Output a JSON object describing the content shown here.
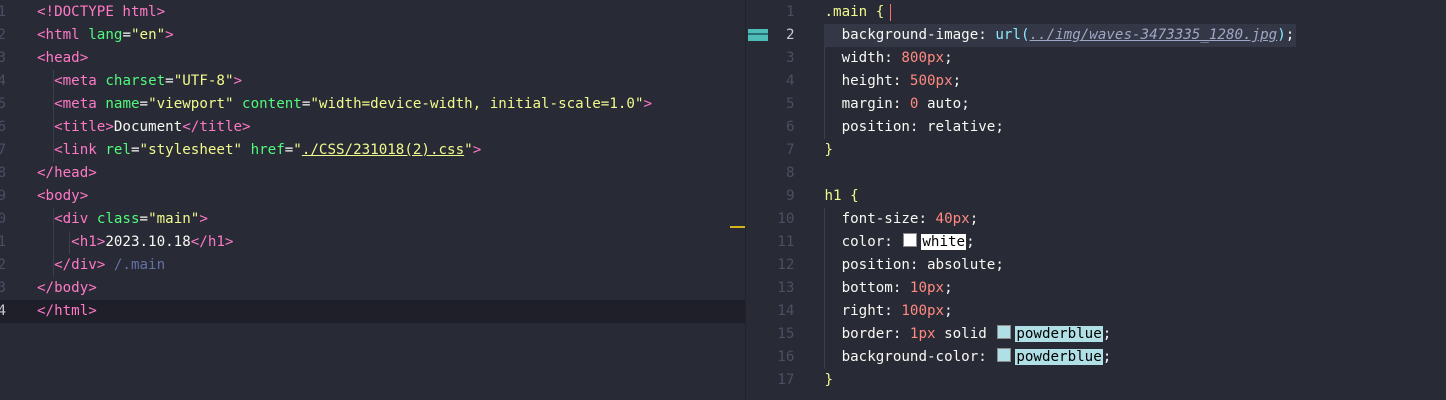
{
  "left_editor": {
    "file_language": "html",
    "lines": [
      {
        "n": "1",
        "parts": [
          [
            "tag",
            "<!DOCTYPE"
          ],
          [
            "txt",
            " "
          ],
          [
            "tag",
            "html"
          ],
          [
            "tag",
            ">"
          ]
        ]
      },
      {
        "n": "2",
        "parts": [
          [
            "tag",
            "<html"
          ],
          [
            "txt",
            " "
          ],
          [
            "attr",
            "lang"
          ],
          [
            "punc",
            "="
          ],
          [
            "str",
            "\"en\""
          ],
          [
            "tag",
            ">"
          ]
        ]
      },
      {
        "n": "3",
        "parts": [
          [
            "tag",
            "<head>"
          ]
        ]
      },
      {
        "n": "4",
        "parts": [
          [
            "txt",
            "  "
          ],
          [
            "tag",
            "<meta"
          ],
          [
            "txt",
            " "
          ],
          [
            "attr",
            "charset"
          ],
          [
            "punc",
            "="
          ],
          [
            "str",
            "\"UTF-8\""
          ],
          [
            "tag",
            ">"
          ]
        ]
      },
      {
        "n": "5",
        "parts": [
          [
            "txt",
            "  "
          ],
          [
            "tag",
            "<meta"
          ],
          [
            "txt",
            " "
          ],
          [
            "attr",
            "name"
          ],
          [
            "punc",
            "="
          ],
          [
            "str",
            "\"viewport\""
          ],
          [
            "txt",
            " "
          ],
          [
            "attr",
            "content"
          ],
          [
            "punc",
            "="
          ],
          [
            "str",
            "\"width=device-width, initial-scale=1.0\""
          ],
          [
            "tag",
            ">"
          ]
        ]
      },
      {
        "n": "6",
        "parts": [
          [
            "txt",
            "  "
          ],
          [
            "tag",
            "<title>"
          ],
          [
            "txt",
            "Document"
          ],
          [
            "tag",
            "</title>"
          ]
        ]
      },
      {
        "n": "7",
        "parts": [
          [
            "txt",
            "  "
          ],
          [
            "tag",
            "<link"
          ],
          [
            "txt",
            " "
          ],
          [
            "attr",
            "rel"
          ],
          [
            "punc",
            "="
          ],
          [
            "str",
            "\"stylesheet\""
          ],
          [
            "txt",
            " "
          ],
          [
            "attr",
            "href"
          ],
          [
            "punc",
            "="
          ],
          [
            "str",
            "\""
          ],
          [
            "link",
            "./CSS/231018(2).css"
          ],
          [
            "str",
            "\""
          ],
          [
            "tag",
            ">"
          ]
        ]
      },
      {
        "n": "8",
        "parts": [
          [
            "tag",
            "</head>"
          ]
        ]
      },
      {
        "n": "9",
        "parts": [
          [
            "tag",
            "<body>"
          ]
        ]
      },
      {
        "n": "0",
        "parts": [
          [
            "txt",
            "  "
          ],
          [
            "tag",
            "<div"
          ],
          [
            "txt",
            " "
          ],
          [
            "attr",
            "class"
          ],
          [
            "punc",
            "="
          ],
          [
            "str",
            "\"main\""
          ],
          [
            "tag",
            ">"
          ]
        ]
      },
      {
        "n": "1",
        "parts": [
          [
            "txt",
            "    "
          ],
          [
            "tag",
            "<h1>"
          ],
          [
            "txt",
            "2023.10.18"
          ],
          [
            "tag",
            "</h1>"
          ]
        ]
      },
      {
        "n": "2",
        "parts": [
          [
            "txt",
            "  "
          ],
          [
            "tag",
            "</div>"
          ],
          [
            "cmt",
            " /.main"
          ]
        ]
      },
      {
        "n": "3",
        "parts": [
          [
            "tag",
            "</body>"
          ]
        ]
      },
      {
        "n": "4",
        "parts": [
          [
            "tag",
            "</html>"
          ]
        ],
        "active": true
      }
    ]
  },
  "right_editor": {
    "file_language": "css",
    "lines": [
      {
        "n": "1",
        "parts": [
          [
            "sel",
            ".main"
          ],
          [
            "txt",
            " "
          ],
          [
            "sel",
            "{"
          ]
        ]
      },
      {
        "n": "2",
        "parts": [
          [
            "txt",
            "  "
          ],
          [
            "prop",
            "background-image"
          ],
          [
            "punc",
            ": "
          ],
          [
            "fn",
            "url("
          ],
          [
            "url",
            "../img/waves-3473335_1280.jpg"
          ],
          [
            "fn",
            ")"
          ],
          [
            "punc",
            ";"
          ]
        ],
        "highlight": true,
        "active": true
      },
      {
        "n": "3",
        "parts": [
          [
            "txt",
            "  "
          ],
          [
            "prop",
            "width"
          ],
          [
            "punc",
            ": "
          ],
          [
            "num",
            "800px"
          ],
          [
            "punc",
            ";"
          ]
        ]
      },
      {
        "n": "4",
        "parts": [
          [
            "txt",
            "  "
          ],
          [
            "prop",
            "height"
          ],
          [
            "punc",
            ": "
          ],
          [
            "num",
            "500px"
          ],
          [
            "punc",
            ";"
          ]
        ]
      },
      {
        "n": "5",
        "parts": [
          [
            "txt",
            "  "
          ],
          [
            "prop",
            "margin"
          ],
          [
            "punc",
            ": "
          ],
          [
            "num",
            "0"
          ],
          [
            "txt",
            " auto"
          ],
          [
            "punc",
            ";"
          ]
        ]
      },
      {
        "n": "6",
        "parts": [
          [
            "txt",
            "  "
          ],
          [
            "prop",
            "position"
          ],
          [
            "punc",
            ": "
          ],
          [
            "txt",
            "relative"
          ],
          [
            "punc",
            ";"
          ]
        ]
      },
      {
        "n": "7",
        "parts": [
          [
            "sel",
            "}"
          ]
        ]
      },
      {
        "n": "8",
        "parts": []
      },
      {
        "n": "9",
        "parts": [
          [
            "sel",
            "h1"
          ],
          [
            "txt",
            " "
          ],
          [
            "sel",
            "{"
          ]
        ]
      },
      {
        "n": "10",
        "parts": [
          [
            "txt",
            "  "
          ],
          [
            "prop",
            "font-size"
          ],
          [
            "punc",
            ": "
          ],
          [
            "num",
            "40px"
          ],
          [
            "punc",
            ";"
          ]
        ]
      },
      {
        "n": "11",
        "parts": [
          [
            "txt",
            "  "
          ],
          [
            "prop",
            "color"
          ],
          [
            "punc",
            ": "
          ],
          [
            "swatch",
            "#ffffff"
          ],
          [
            "box-white",
            "white"
          ],
          [
            "punc",
            ";"
          ]
        ]
      },
      {
        "n": "12",
        "parts": [
          [
            "txt",
            "  "
          ],
          [
            "prop",
            "position"
          ],
          [
            "punc",
            ": "
          ],
          [
            "txt",
            "absolute"
          ],
          [
            "punc",
            ";"
          ]
        ]
      },
      {
        "n": "13",
        "parts": [
          [
            "txt",
            "  "
          ],
          [
            "prop",
            "bottom"
          ],
          [
            "punc",
            ": "
          ],
          [
            "num",
            "10px"
          ],
          [
            "punc",
            ";"
          ]
        ]
      },
      {
        "n": "14",
        "parts": [
          [
            "txt",
            "  "
          ],
          [
            "prop",
            "right"
          ],
          [
            "punc",
            ": "
          ],
          [
            "num",
            "100px"
          ],
          [
            "punc",
            ";"
          ]
        ]
      },
      {
        "n": "15",
        "parts": [
          [
            "txt",
            "  "
          ],
          [
            "prop",
            "border"
          ],
          [
            "punc",
            ": "
          ],
          [
            "num",
            "1px"
          ],
          [
            "txt",
            " solid "
          ],
          [
            "swatch",
            "#b0e0e6"
          ],
          [
            "box-pb",
            "powderblue"
          ],
          [
            "punc",
            ";"
          ]
        ]
      },
      {
        "n": "16",
        "parts": [
          [
            "txt",
            "  "
          ],
          [
            "prop",
            "background-color"
          ],
          [
            "punc",
            ": "
          ],
          [
            "swatch",
            "#b0e0e6"
          ],
          [
            "box-pb",
            "powderblue"
          ],
          [
            "punc",
            ";"
          ]
        ]
      },
      {
        "n": "17",
        "parts": [
          [
            "sel",
            "}"
          ]
        ]
      }
    ]
  },
  "colors": {
    "background": "#282a36",
    "tag": "#ff79c6",
    "attr": "#50fa7b",
    "string": "#f1fa8c",
    "number": "#ff8a80",
    "powderblue": "#b0e0e6",
    "white": "#ffffff"
  }
}
